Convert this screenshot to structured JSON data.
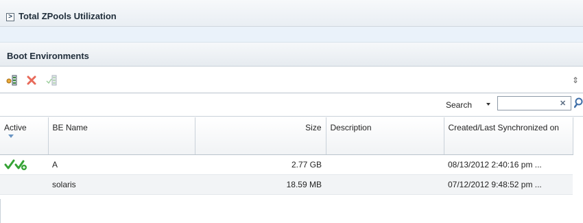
{
  "zpools": {
    "title": "Total ZPools Utilization",
    "expander": ">"
  },
  "boot_env": {
    "title": "Boot Environments",
    "toolbar": {
      "actions": [
        {
          "icon": "create-be-icon"
        },
        {
          "icon": "delete-icon"
        },
        {
          "icon": "activate-be-icon"
        }
      ],
      "refresh_icon": "refresh-icon"
    },
    "search": {
      "label": "Search",
      "value": "",
      "clear_icon": "clear-icon",
      "go_icon": "search-icon"
    },
    "table": {
      "columns": [
        "Active",
        "BE Name",
        "Size",
        "Description",
        "Created/Last Synchronized on"
      ],
      "rows": [
        {
          "active": true,
          "name": "A",
          "size": "2.77 GB",
          "description": "",
          "created": "08/13/2012 2:40:16 pm ..."
        },
        {
          "active": false,
          "name": "solaris",
          "size": "18.59 MB",
          "description": "",
          "created": "07/12/2012 9:48:52 pm ..."
        }
      ]
    }
  },
  "colors": {
    "accent": "#2a9d2a",
    "delete": "#e05a4a",
    "header_text": "#1f2d3a"
  }
}
